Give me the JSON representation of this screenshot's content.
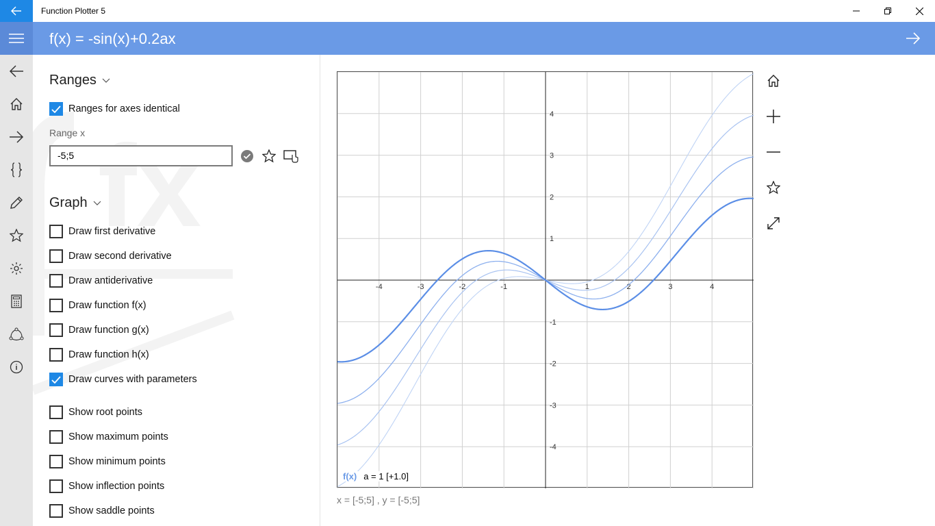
{
  "window": {
    "title": "Function Plotter 5"
  },
  "header": {
    "formula": "f(x) = -sin(x)+0.2ax"
  },
  "ranges": {
    "heading": "Ranges",
    "identical_label": "Ranges for axes identical",
    "identical_checked": true,
    "range_x_label": "Range x",
    "range_x_value": "-5;5"
  },
  "graph": {
    "heading": "Graph",
    "options": [
      {
        "label": "Draw first derivative",
        "checked": false
      },
      {
        "label": "Draw second derivative",
        "checked": false
      },
      {
        "label": "Draw antiderivative",
        "checked": false
      },
      {
        "label": "Draw function f(x)",
        "checked": false
      },
      {
        "label": "Draw function g(x)",
        "checked": false
      },
      {
        "label": "Draw function h(x)",
        "checked": false
      },
      {
        "label": "Draw curves with parameters",
        "checked": true
      },
      {
        "label": "Show root points",
        "checked": false
      },
      {
        "label": "Show maximum points",
        "checked": false
      },
      {
        "label": "Show minimum points",
        "checked": false
      },
      {
        "label": "Show inflection points",
        "checked": false
      },
      {
        "label": "Show saddle points",
        "checked": false
      }
    ]
  },
  "legend": {
    "fx": "f(x)",
    "param": "a = 1 [+1.0]"
  },
  "readout": "x = [-5;5] , y = [-5;5]",
  "colors": {
    "accent": "#1e88e5",
    "header": "#6a9ae6",
    "curve": "#5b8ee6"
  },
  "chart_data": {
    "type": "line",
    "xlim": [
      -5,
      5
    ],
    "ylim": [
      -5,
      5
    ],
    "xticks": [
      "-4",
      "-3",
      "-2",
      "-1",
      "1",
      "2",
      "3",
      "4"
    ],
    "yticks": [
      "4",
      "3",
      "2",
      "1",
      "-1",
      "-2",
      "-3",
      "-4"
    ],
    "grid": true,
    "series": [
      {
        "a": 1,
        "highlighted": true
      },
      {
        "a": 2
      },
      {
        "a": 3
      },
      {
        "a": 4
      }
    ]
  }
}
